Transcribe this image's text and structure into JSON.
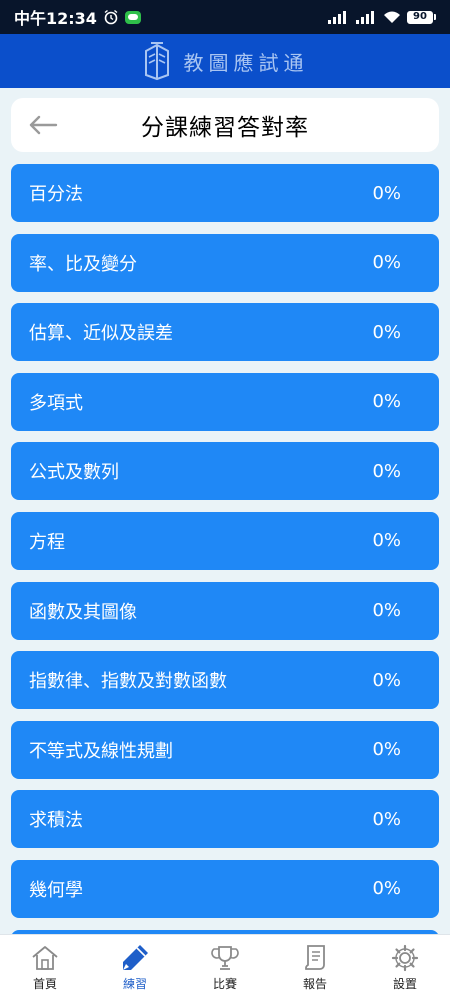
{
  "status_bar": {
    "time": "中午12:34",
    "battery": "90",
    "icons": [
      "alarm-icon",
      "wechat-icon",
      "signal-icon",
      "wifi-icon",
      "battery-icon"
    ]
  },
  "header": {
    "app_name": "教圖應試通",
    "logo_icon": "book-logo-icon",
    "color": "#0b4fcb"
  },
  "title_card": {
    "back_icon": "back-arrow-icon",
    "title": "分課練習答對率"
  },
  "lessons": [
    {
      "name": "百分法",
      "rate": "0%"
    },
    {
      "name": "率、比及變分",
      "rate": "0%"
    },
    {
      "name": "估算、近似及誤差",
      "rate": "0%"
    },
    {
      "name": "多項式",
      "rate": "0%"
    },
    {
      "name": "公式及數列",
      "rate": "0%"
    },
    {
      "name": "方程",
      "rate": "0%"
    },
    {
      "name": "函數及其圖像",
      "rate": "0%"
    },
    {
      "name": "指數律、指數及對數函數",
      "rate": "0%"
    },
    {
      "name": "不等式及線性規劃",
      "rate": "0%"
    },
    {
      "name": "求積法",
      "rate": "0%"
    },
    {
      "name": "幾何學",
      "rate": "0%"
    }
  ],
  "lesson_color": "#1f88f6",
  "bottom_nav": [
    {
      "label": "首頁",
      "icon": "home-icon"
    },
    {
      "label": "練習",
      "icon": "pencil-icon",
      "active": true
    },
    {
      "label": "比賽",
      "icon": "trophy-icon"
    },
    {
      "label": "報告",
      "icon": "scroll-icon"
    },
    {
      "label": "設置",
      "icon": "gear-icon"
    }
  ]
}
